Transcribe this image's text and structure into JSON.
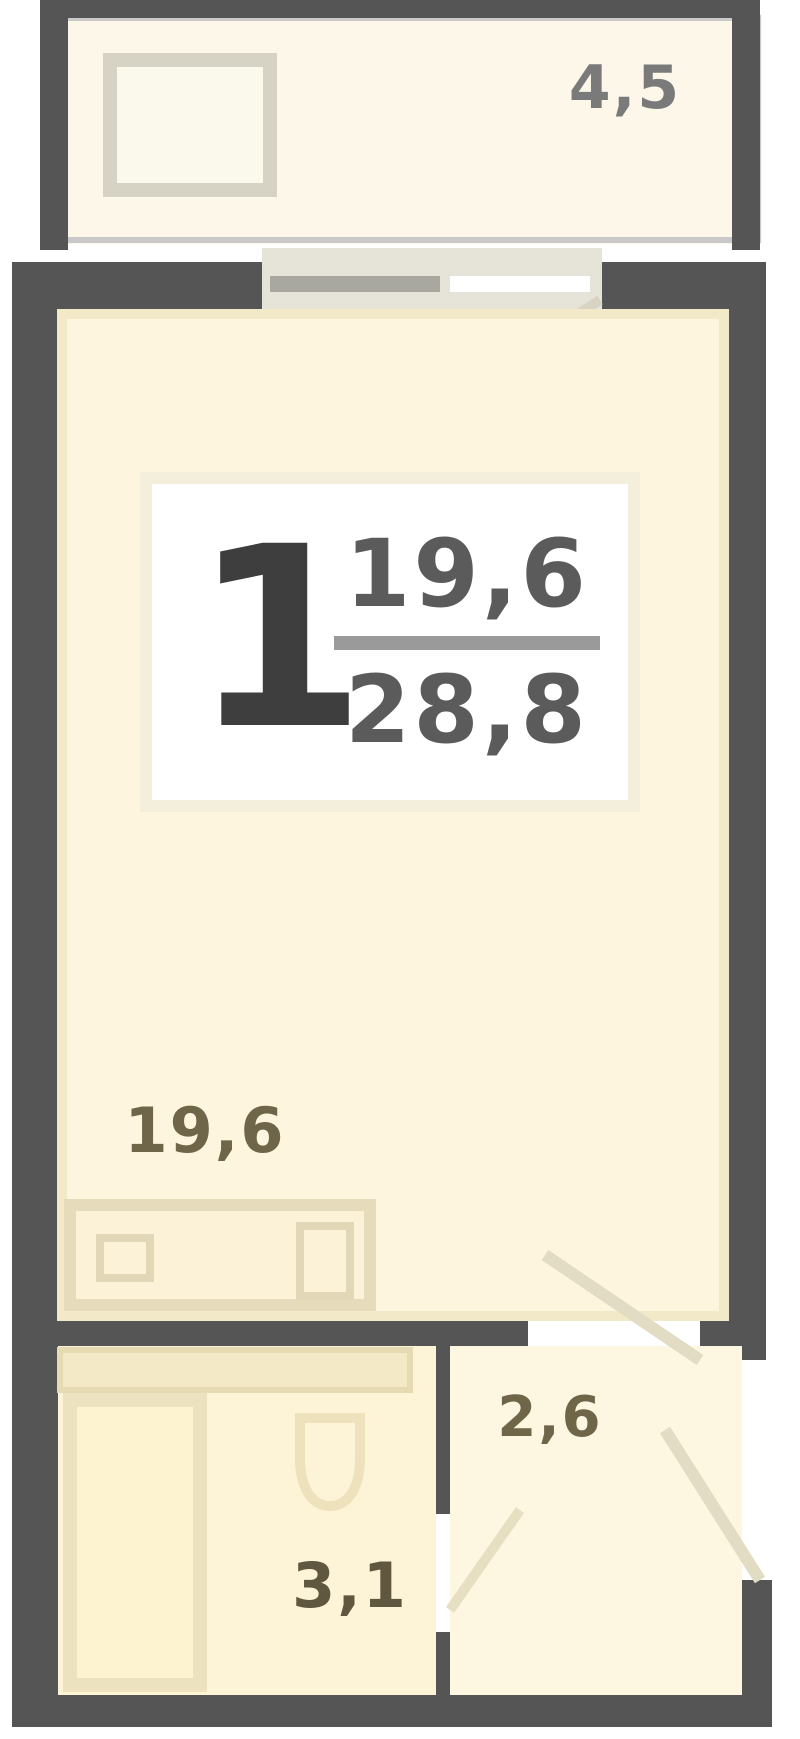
{
  "plan": {
    "balcony_area": "4,5",
    "living_area": "19,6",
    "hall_area": "2,6",
    "bath_area": "3,1"
  },
  "summary": {
    "rooms": "1",
    "living_area": "19,6",
    "total_area": "28,8"
  },
  "colors": {
    "wall": "#555555",
    "floor": "#fdf5dd",
    "balcony_floor": "#fcf7e8",
    "fixture_outline": "#e0d9c2"
  }
}
